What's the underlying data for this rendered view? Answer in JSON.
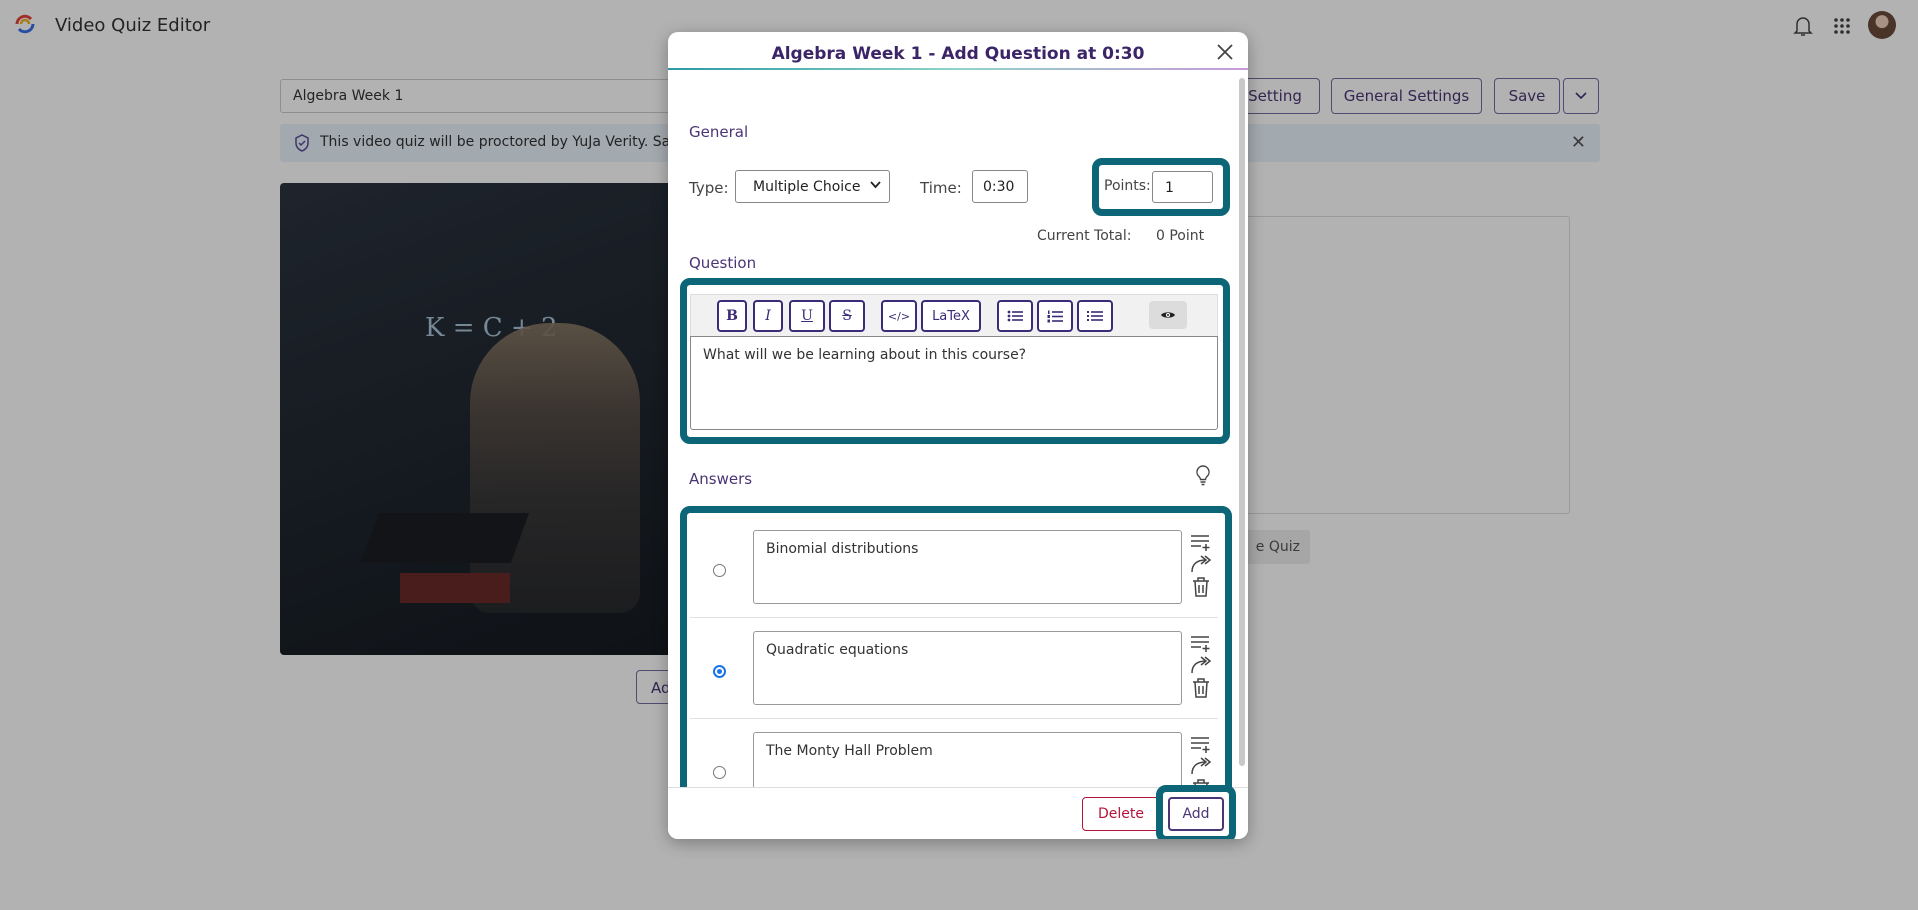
{
  "app": {
    "title": "Video Quiz Editor"
  },
  "quiz": {
    "name": "Algebra Week 1"
  },
  "toolbar": {
    "setting_label": "Setting",
    "general_settings_label": "General Settings",
    "save_label": "Save"
  },
  "banner": {
    "text": "This video quiz will be proctored by YuJa Verity. Save"
  },
  "background": {
    "take_quiz_label": "e Quiz",
    "add_label": "Ad",
    "panel_label": ":"
  },
  "modal": {
    "title": "Algebra Week 1 - Add Question at 0:30",
    "general_label": "General",
    "type_label": "Type:",
    "type_value": "Multiple Choice",
    "time_label": "Time:",
    "time_value": "0:30",
    "points_label": "Points:",
    "points_value": "1",
    "current_total_label": "Current Total:",
    "current_total_value": "0 Point",
    "question_label": "Question",
    "editor": {
      "bold": "B",
      "italic": "I",
      "underline": "U",
      "strike": "S",
      "code": "</>",
      "latex": "LaTeX"
    },
    "question_text": "What will we be learning about in this course?",
    "answers_label": "Answers",
    "answers": [
      {
        "text": "Binomial distributions",
        "selected": false
      },
      {
        "text": "Quadratic equations",
        "selected": true
      },
      {
        "text": "The Monty Hall Problem",
        "selected": false
      }
    ],
    "delete_label": "Delete",
    "add_label": "Add"
  },
  "colors": {
    "accent": "#4a3575",
    "highlight": "#0c6678",
    "danger": "#b3143a"
  }
}
